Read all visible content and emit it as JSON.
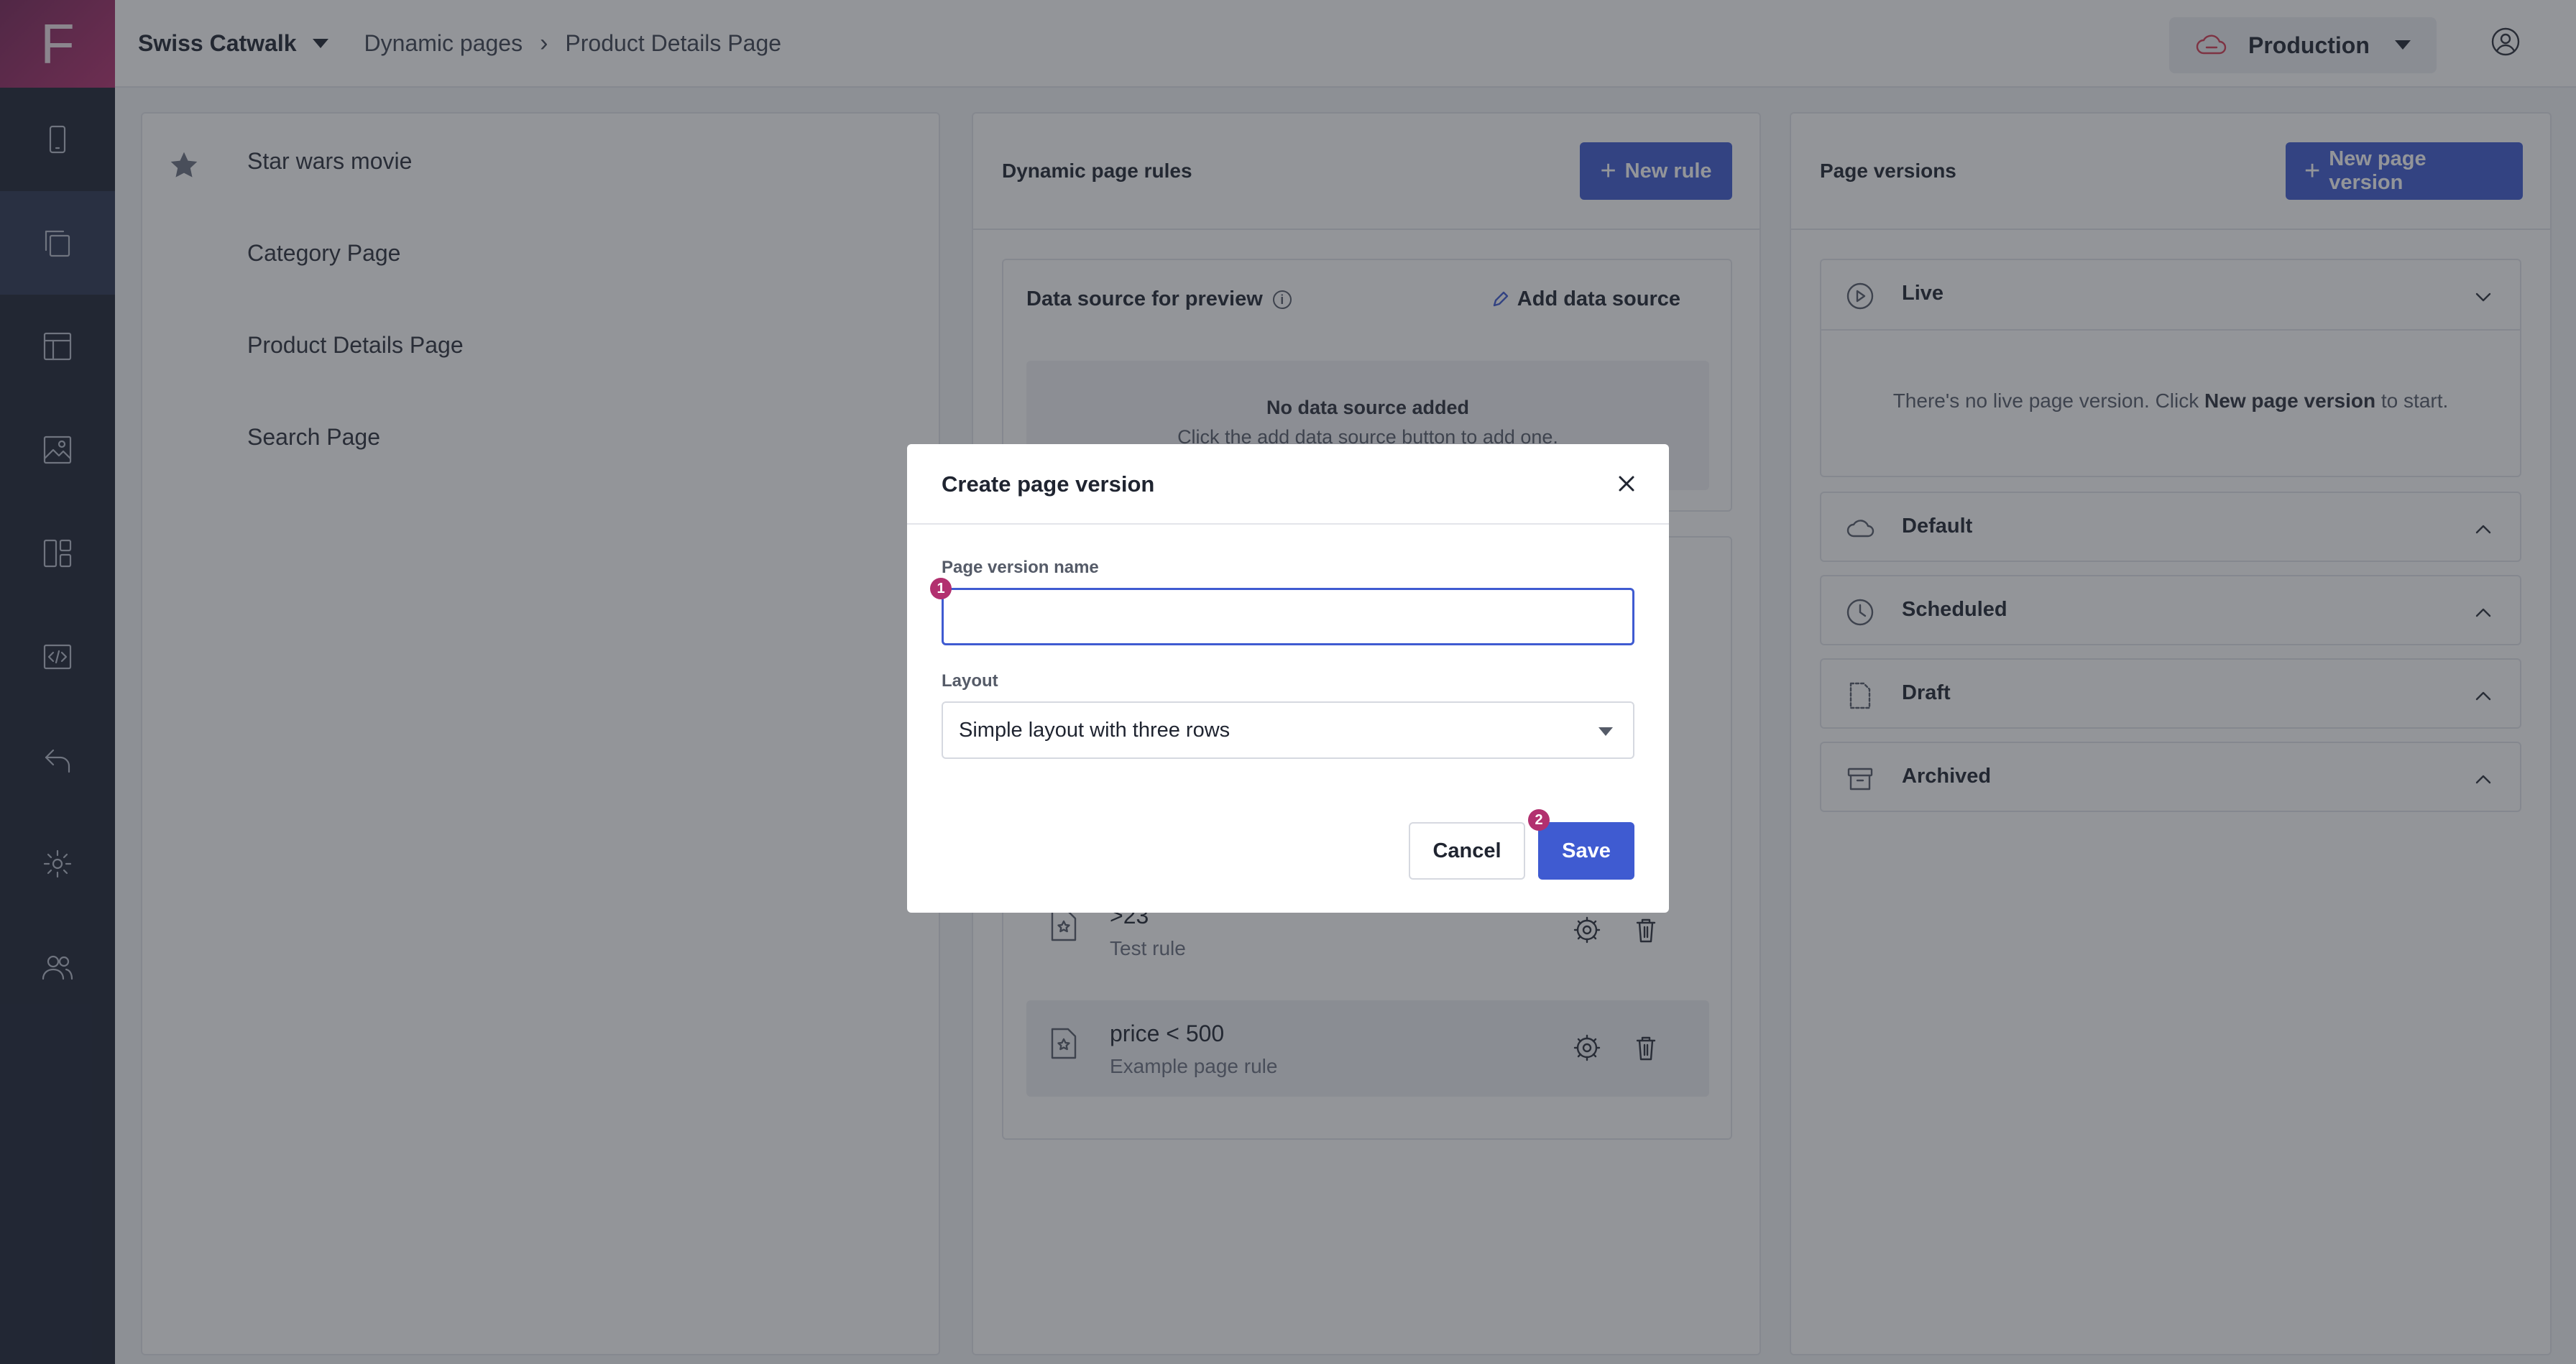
{
  "app": {
    "logo_letter": "F",
    "project": "Swiss Catwalk",
    "breadcrumb": [
      "Dynamic pages",
      "Product Details Page"
    ],
    "environment": "Production"
  },
  "sidebar_icons": [
    "tablet-icon",
    "pages-icon",
    "layout-icon",
    "media-icon",
    "components-icon",
    "code-icon",
    "undo-icon",
    "settings-icon",
    "users-icon"
  ],
  "pages_list": [
    "Star wars movie",
    "Category Page",
    "Product Details Page",
    "Search Page"
  ],
  "rules_panel": {
    "title": "Dynamic page rules",
    "new_rule": "New rule",
    "datasource_title": "Data source for preview",
    "add_datasource": "Add data source",
    "empty_title": "No data source added",
    "empty_hint": "Click the add data source button to add one.",
    "rules": [
      {
        "name": ">23",
        "desc": "Test rule"
      },
      {
        "name": "price < 500",
        "desc": "Example page rule"
      }
    ]
  },
  "versions_panel": {
    "title": "Page versions",
    "new_version": "New page version",
    "sections": [
      {
        "label": "Live",
        "icon": "play-circle-icon"
      },
      {
        "label": "Default",
        "icon": "cloud-icon"
      },
      {
        "label": "Scheduled",
        "icon": "clock-icon"
      },
      {
        "label": "Draft",
        "icon": "draft-file-icon"
      },
      {
        "label": "Archived",
        "icon": "archive-icon"
      }
    ],
    "live_empty_pre": "There's no live page version. Click ",
    "live_empty_strong": "New page version",
    "live_empty_post": " to start."
  },
  "modal": {
    "title": "Create page version",
    "name_label": "Page version name",
    "name_value": "",
    "layout_label": "Layout",
    "layout_value": "Simple layout with three rows",
    "cancel": "Cancel",
    "save": "Save",
    "badge1": "1",
    "badge2": "2"
  },
  "colors": {
    "primary": "#3f5bd1",
    "brand": "#b2306f",
    "rail": "#1c2233"
  }
}
